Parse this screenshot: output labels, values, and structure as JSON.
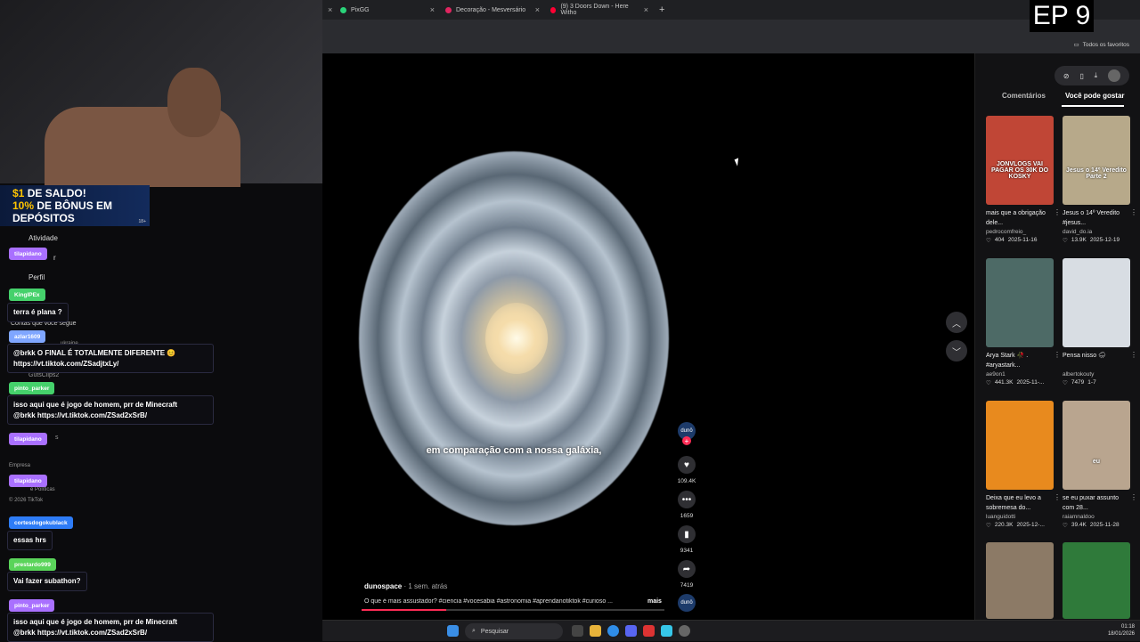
{
  "browser": {
    "tabs": [
      {
        "label": "PixGG",
        "color": "#2ad47a"
      },
      {
        "label": "Decoração - Mesversário",
        "color": "#e02560"
      },
      {
        "label": "(9) 3 Doors Down - Here Witho",
        "color": "#ff0033"
      }
    ],
    "bookmarks_label": "Todos os favoritos"
  },
  "overlay": {
    "episode": "EP 9",
    "promo_line1_gold": "$1",
    "promo_line1": " DE SALDO!",
    "promo_line2_gold": "10%",
    "promo_line2": " DE BÔNUS EM DEPÓSITOS",
    "promo_age": "18+"
  },
  "sidebar_ghost": {
    "activity": "Atividade",
    "upload": "r",
    "profile": "Perfil",
    "following_title": "Contas que você segue",
    "f1": "ukraine",
    "f2": "GutsClips2",
    "f3": "d4rkkham",
    "f4": "s",
    "company": "Empresa",
    "policies": "e Políticas",
    "copyright": "© 2026 TikTok"
  },
  "chat": [
    {
      "user": "tilapidano",
      "color": "#a970ff",
      "message": ""
    },
    {
      "user": "KingIPEx",
      "color": "#45d16b",
      "message": "terra é plana ?"
    },
    {
      "user": "azlar1609",
      "color": "#7fa6ff",
      "message": "@brkk O FINAL É TOTALMENTE DIFERENTE 😊\nhttps://vt.tiktok.com/ZSadjtxLy/"
    },
    {
      "user": "pinto_parker",
      "color": "#45d16b",
      "message": "isso aqui que é jogo de homem, prr de Minecraft\n@brkk https://vt.tiktok.com/ZSad2xSrB/"
    },
    {
      "user": "tilapidano",
      "color": "#a970ff",
      "message": ""
    },
    {
      "user": "tilapidano",
      "color": "#a970ff",
      "message": ""
    },
    {
      "user": "cortesdogokublack",
      "color": "#2e7cf6",
      "message": "essas hrs"
    },
    {
      "user": "prestardo999",
      "color": "#5ad45a",
      "message": "Vai fazer subathon?"
    },
    {
      "user": "pinto_parker",
      "color": "#a970ff",
      "message": "isso aqui que é jogo de homem, prr de Minecraft\n@brkk https://vt.tiktok.com/ZSad2xSrB/"
    }
  ],
  "video": {
    "subtitle": "em comparação com a nossa galáxia,",
    "author": "dunospace",
    "posted": " · 1 sem. atrás",
    "description": "O que é mais assustador? #ciencia #vocesabia #astronomia #aprendanotiktok #curioso ...",
    "more": "mais",
    "progress": 0.28,
    "likes": "109.4K",
    "comments": "1659",
    "saves": "9341",
    "shares": "7419"
  },
  "right_panel": {
    "tab_comments": "Comentários",
    "tab_suggested": "Você pode gostar",
    "cards": [
      {
        "title": "mais que a obrigação dele...",
        "user": "pedrocomfreio_",
        "likes": "404",
        "date": "2025-11-16",
        "thumb_text": "JONVLOGS VAI PAGAR OS 30K DO KOSKY",
        "bg": "#c04636"
      },
      {
        "title": "Jesus o 14º Veredito #jesus...",
        "user": "david_do.ia",
        "likes": "13.9K",
        "date": "2025-12-19",
        "thumb_text": "Jesus o 14º Veredito Parte 2",
        "bg": "#b7a98a"
      },
      {
        "title": "Arya Stark 🥀 . #aryastark...",
        "user": "ae9on1",
        "likes": "441.3K",
        "date": "2025-11-...",
        "thumb_text": "",
        "bg": "#4d6a66"
      },
      {
        "title": "Pensa nisso 🌧",
        "user": "albertokouty",
        "likes": "7479",
        "date": "1-7",
        "thumb_text": "",
        "bg": "#d8dde3"
      },
      {
        "title": "Deixa que eu levo a sobremesa do...",
        "user": "luanguidotti",
        "likes": "220.3K",
        "date": "2025-12-...",
        "thumb_text": "",
        "bg": "#e88a1e"
      },
      {
        "title": "se eu puxar assunto com 28...",
        "user": "raiamnaldoo",
        "likes": "39.4K",
        "date": "2025-11-28",
        "thumb_text": "eu",
        "bg": "#b9a58f"
      },
      {
        "title": "",
        "user": "",
        "likes": "",
        "date": "",
        "thumb_text": "",
        "bg": "#8c7a66"
      },
      {
        "title": "",
        "user": "",
        "likes": "",
        "date": "",
        "thumb_text": "",
        "bg": "#2f7a3a"
      }
    ]
  },
  "taskbar": {
    "search": "Pesquisar",
    "time": "01:18",
    "date": "18/01/2026"
  }
}
